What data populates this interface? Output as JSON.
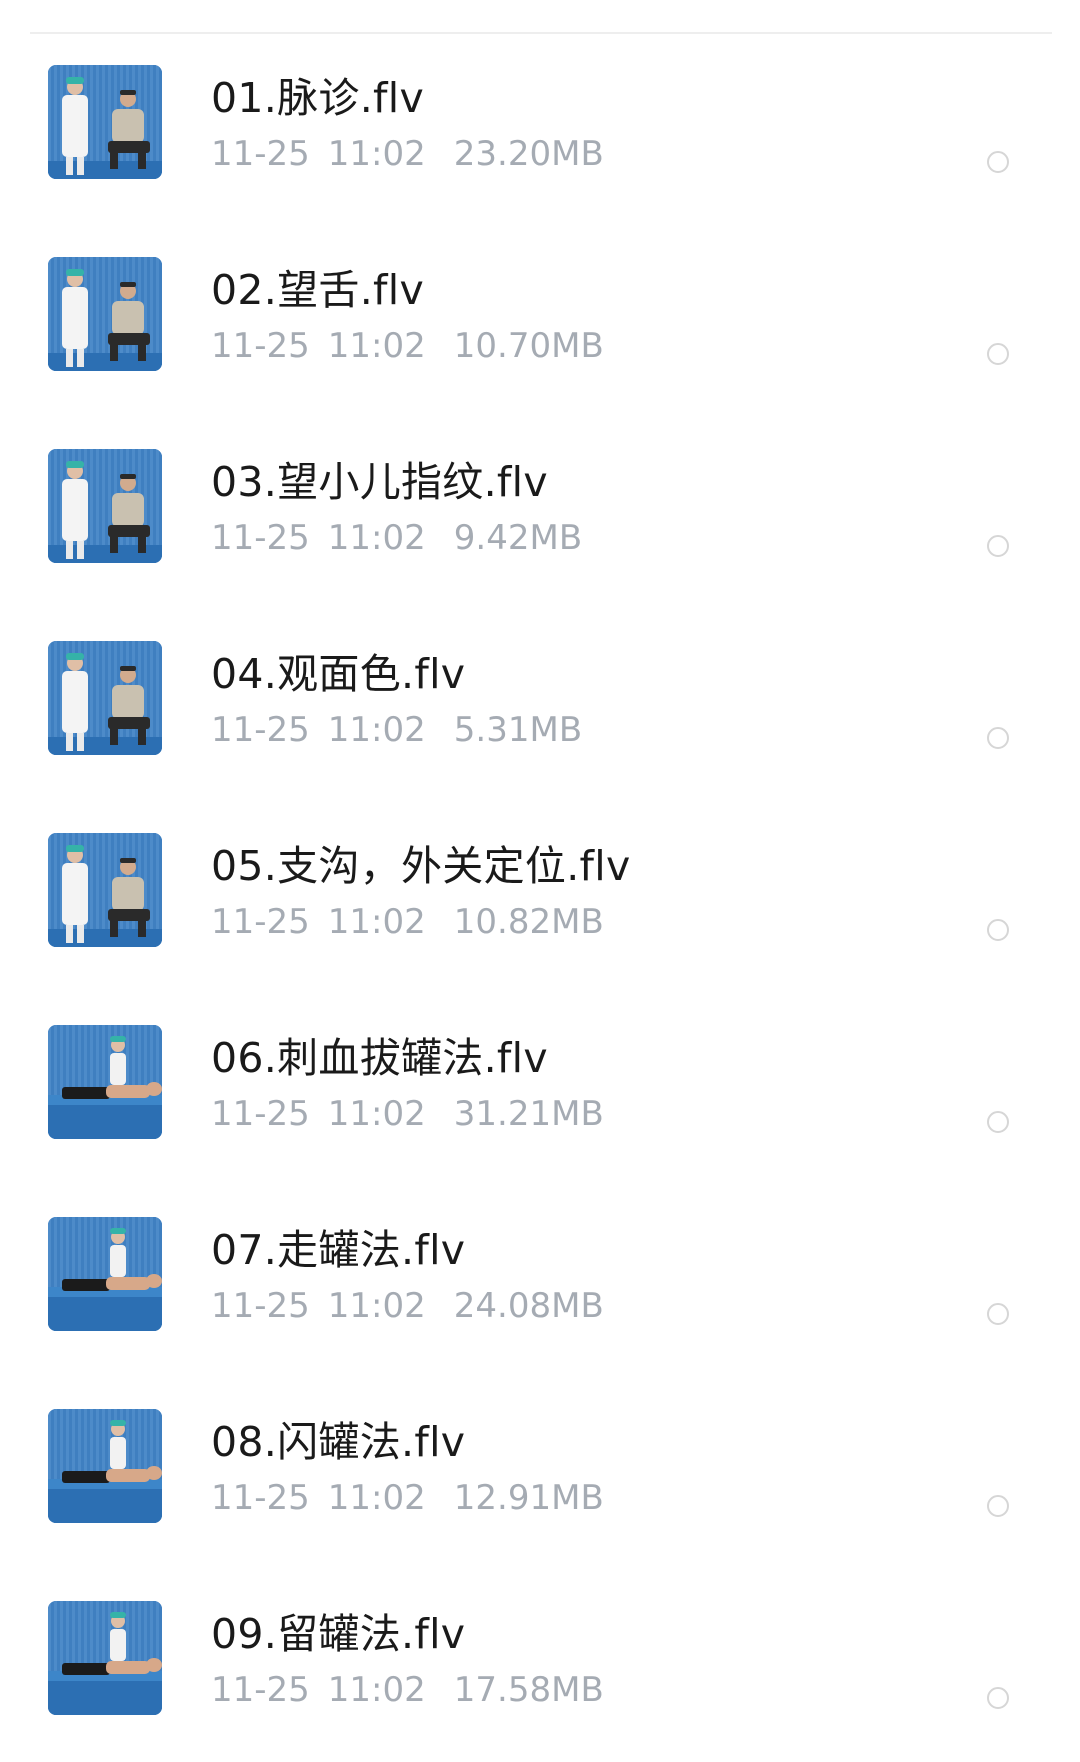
{
  "files": [
    {
      "name": "01.脉诊.flv",
      "date": "11-25",
      "time": "11:02",
      "size": "23.20MB",
      "thumb_icon": "video-thumbnail-icon",
      "scene": "clinic-seated"
    },
    {
      "name": "02.望舌.flv",
      "date": "11-25",
      "time": "11:02",
      "size": "10.70MB",
      "thumb_icon": "video-thumbnail-icon",
      "scene": "standing-seated"
    },
    {
      "name": "03.望小儿指纹.flv",
      "date": "11-25",
      "time": "11:02",
      "size": "9.42MB",
      "thumb_icon": "video-thumbnail-icon",
      "scene": "standing-seated"
    },
    {
      "name": "04.观面色.flv",
      "date": "11-25",
      "time": "11:02",
      "size": "5.31MB",
      "thumb_icon": "video-thumbnail-icon",
      "scene": "standing-seated"
    },
    {
      "name": "05.支沟，外关定位.flv",
      "date": "11-25",
      "time": "11:02",
      "size": "10.82MB",
      "thumb_icon": "video-thumbnail-icon",
      "scene": "standing-seated"
    },
    {
      "name": "06.刺血拔罐法.flv",
      "date": "11-25",
      "time": "11:02",
      "size": "31.21MB",
      "thumb_icon": "video-thumbnail-icon",
      "scene": "lying"
    },
    {
      "name": "07.走罐法.flv",
      "date": "11-25",
      "time": "11:02",
      "size": "24.08MB",
      "thumb_icon": "video-thumbnail-icon",
      "scene": "lying"
    },
    {
      "name": "08.闪罐法.flv",
      "date": "11-25",
      "time": "11:02",
      "size": "12.91MB",
      "thumb_icon": "video-thumbnail-icon",
      "scene": "lying"
    },
    {
      "name": "09.留罐法.flv",
      "date": "11-25",
      "time": "11:02",
      "size": "17.58MB",
      "thumb_icon": "video-thumbnail-icon",
      "scene": "lying"
    }
  ],
  "colors": {
    "name_text": "#1a1a1a",
    "meta_text": "#a5abb3",
    "radio_border": "#d6d6d6",
    "divider": "#eeeeee",
    "thumb_curtain": "#3f7fc0"
  }
}
